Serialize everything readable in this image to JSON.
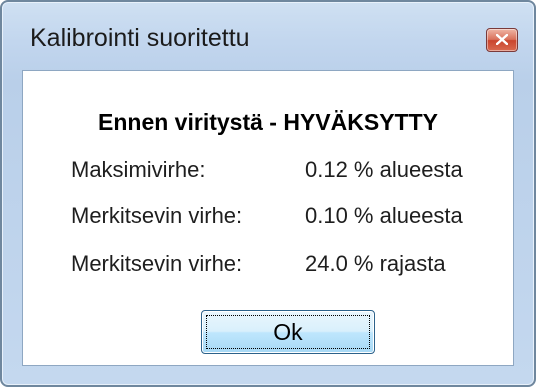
{
  "window": {
    "title": "Kalibrointi suoritettu",
    "close_icon": "close-icon"
  },
  "content": {
    "heading": "Ennen viritystä - HYVÄKSYTTY",
    "rows": [
      {
        "label": "Maksimivirhe:",
        "value": "0.12 % alueesta"
      },
      {
        "label": "Merkitsevin virhe:",
        "value": "0.10 % alueesta"
      },
      {
        "label": "Merkitsevin virhe:",
        "value": "24.0 % rajasta"
      }
    ]
  },
  "buttons": {
    "ok_label": "Ok"
  },
  "colors": {
    "title_bar": "#c2d6ee",
    "close_button": "#c9452e",
    "ok_button": "#bee6fd"
  }
}
